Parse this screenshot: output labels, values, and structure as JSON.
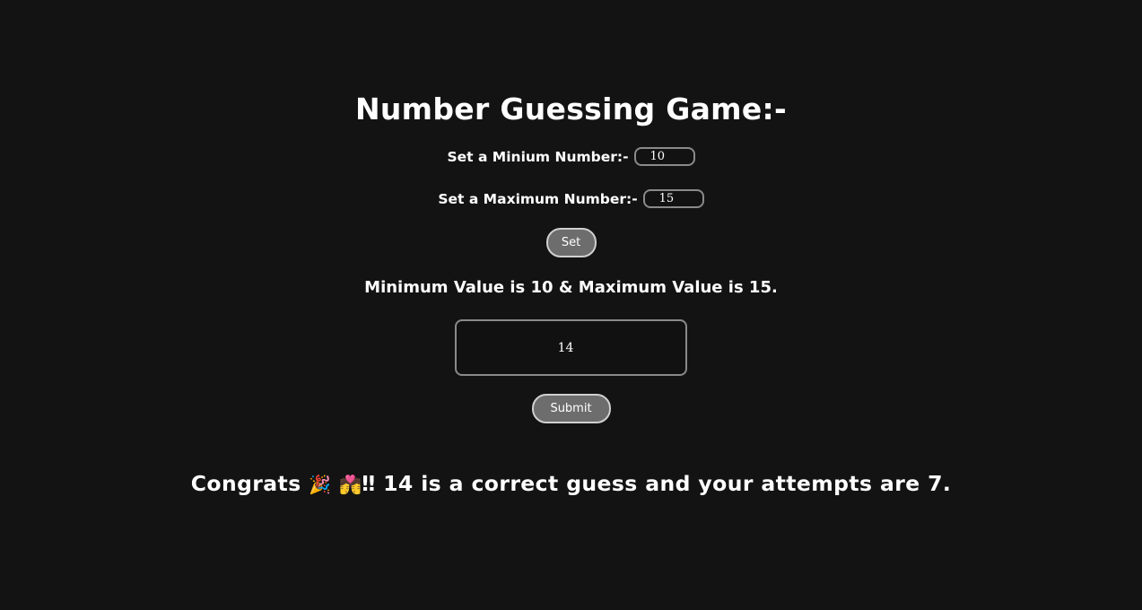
{
  "title": "Number Guessing Game:-",
  "min": {
    "label": "Set a Minium Number:-",
    "value": "10"
  },
  "max": {
    "label": "Set a Maximum Number:-",
    "value": "15"
  },
  "set_button": "Set",
  "range_text": "Minimum Value is 10 & Maximum Value is 15.",
  "guess": {
    "value": "14"
  },
  "submit_button": "Submit",
  "result": {
    "prefix": "Congrats",
    "emoji_party": "🎉",
    "emoji_couple": "💏",
    "text": "‼ 14 is a correct guess and your attempts are 7."
  }
}
